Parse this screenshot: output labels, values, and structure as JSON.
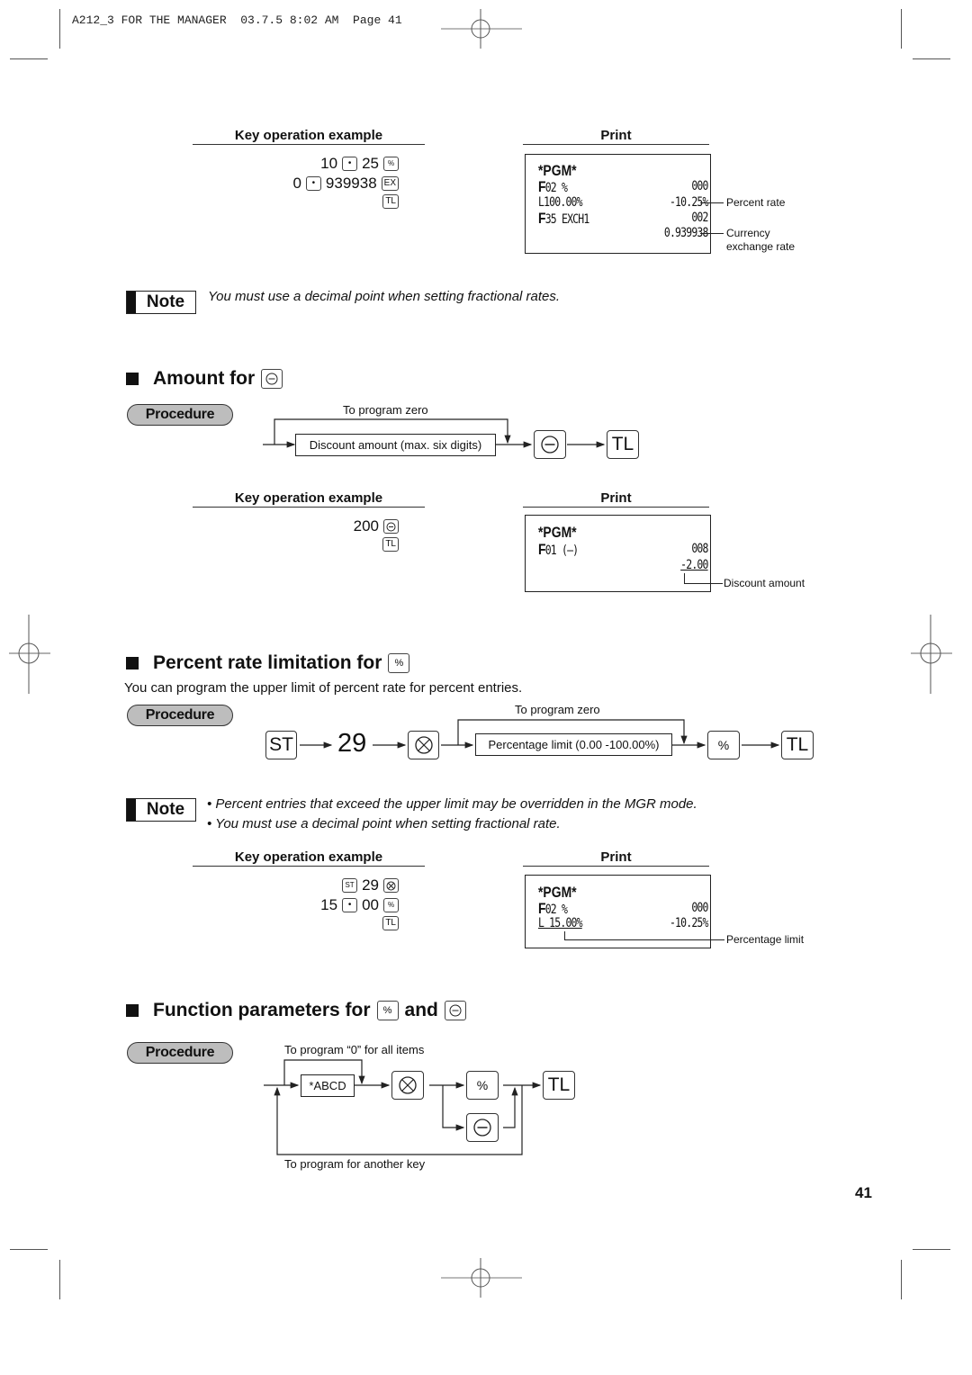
{
  "header": {
    "job_line": "A212_3 FOR THE MANAGER  03.7.5 8:02 AM  Page 41"
  },
  "section_rate_example": {
    "key_title": "Key operation example",
    "print_title": "Print",
    "key_lines": [
      {
        "tokens": [
          "10",
          "[·]",
          "25",
          "[%]"
        ]
      },
      {
        "tokens": [
          "0",
          "[·]",
          "939938",
          "[EX]"
        ]
      },
      {
        "tokens": [
          "[TL]"
        ]
      }
    ],
    "receipt": {
      "header": "*PGM*",
      "rows": [
        {
          "left_f": "F",
          "left": "02 %",
          "right": "000"
        },
        {
          "left_f": "",
          "left": "L100.00%",
          "right": "-10.25%"
        },
        {
          "left_f": "F",
          "left": "35 EXCH1",
          "right": "002"
        },
        {
          "left_f": "",
          "left": "",
          "right": "0.939938"
        }
      ]
    },
    "annotations": {
      "percent_rate": "Percent rate",
      "currency_rate": "Currency\nexchange rate"
    }
  },
  "note1": {
    "badge": "Note",
    "text": "You must use a decimal point when setting fractional rates."
  },
  "amount_section": {
    "title": "Amount for",
    "title_key": "minus-key",
    "procedure_label": "Procedure",
    "flow": {
      "loop_label": "To program zero",
      "box_label": "Discount amount (max. six digits)",
      "key_tl": "TL"
    },
    "key_title": "Key operation example",
    "print_title": "Print",
    "key_lines": [
      {
        "tokens": [
          "200",
          "[⊖]"
        ]
      },
      {
        "tokens": [
          "[TL]"
        ]
      }
    ],
    "receipt": {
      "header": "*PGM*",
      "rows": [
        {
          "left_f": "F",
          "left": "01 (—)",
          "right": "008"
        },
        {
          "left_f": "",
          "left": "",
          "right": "-2.00"
        }
      ]
    },
    "annotation": "Discount amount"
  },
  "percent_section": {
    "title": "Percent rate limitation for",
    "title_key": "%",
    "description": "You can program the upper limit of percent rate for percent entries.",
    "procedure_label": "Procedure",
    "flow": {
      "st_key": "ST",
      "number": "29",
      "loop_label": "To program zero",
      "box_label": "Percentage limit (0.00 -100.00%)",
      "percent_key": "%",
      "key_tl": "TL"
    },
    "note": {
      "badge": "Note",
      "bullets": [
        "• Percent entries that exceed the upper limit may be overridden in the MGR mode.",
        "• You must use a decimal point when setting fractional rate."
      ]
    },
    "key_title": "Key operation example",
    "print_title": "Print",
    "key_lines": [
      {
        "tokens": [
          "[ST]",
          "29",
          "[⊗]"
        ]
      },
      {
        "tokens": [
          "15",
          "[·]",
          "00",
          "[%]"
        ]
      },
      {
        "tokens": [
          "[TL]"
        ]
      }
    ],
    "receipt": {
      "header": "*PGM*",
      "rows": [
        {
          "left_f": "F",
          "left": "02 %",
          "right": "000"
        },
        {
          "left_f": "",
          "left": "L 15.00%",
          "right": "-10.25%"
        }
      ]
    },
    "annotation": "Percentage limit"
  },
  "function_section": {
    "title_prefix": "Function parameters for",
    "title_key1": "%",
    "title_and": "and",
    "title_key2": "minus-key",
    "procedure_label": "Procedure",
    "flow": {
      "top_label": "To program “0” for all items",
      "box_label": "*ABCD",
      "percent_key": "%",
      "key_tl": "TL",
      "bottom_label": "To program for another key"
    }
  },
  "page_number": "41"
}
